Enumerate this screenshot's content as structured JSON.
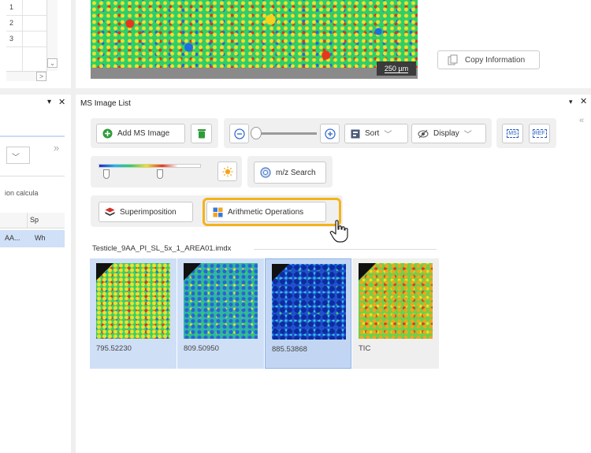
{
  "top_grid": {
    "rows": [
      "1",
      "2",
      "3"
    ],
    "scroll_down_glyph": "⌄",
    "scroll_right_glyph": ">"
  },
  "top_image": {
    "scale_label": "250 µm"
  },
  "copy_info": {
    "label": "Copy Information",
    "icon": "copy-icon"
  },
  "left_panel": {
    "pin_glyph": "▾",
    "close_glyph": "✕",
    "expand_glyph": "»",
    "dropdown_glyph": "﹀",
    "calc_text": "ion calcula",
    "table_header": [
      "",
      "Sp"
    ],
    "table_row": [
      "AA...",
      "Wh"
    ]
  },
  "ms_list": {
    "title": "MS Image List",
    "pin_glyph": "▾",
    "close_glyph": "✕",
    "collapse_glyph": "«",
    "add_label": "Add MS Image",
    "sort_label": "Sort",
    "display_label": "Display",
    "ms_button_label": "MS",
    "ref_button_label": "REF",
    "mz_search_label": "m/z Search",
    "superimposition_label": "Superimposition",
    "arithmetic_label": "Arithmetic Operations",
    "file_name": "Testicle_9AA_PI_SL_5x_1_AREA01.imdx",
    "thumbnails": [
      {
        "label": "795.52230",
        "selected": true
      },
      {
        "label": "809.50950",
        "selected": true
      },
      {
        "label": "885.53868",
        "selected": true
      },
      {
        "label": "TIC",
        "selected": false
      }
    ]
  },
  "colors": {
    "accent_highlight": "#f4b31a",
    "selection_bg": "#cfdff6",
    "add_icon_green": "#2e9c3a"
  }
}
